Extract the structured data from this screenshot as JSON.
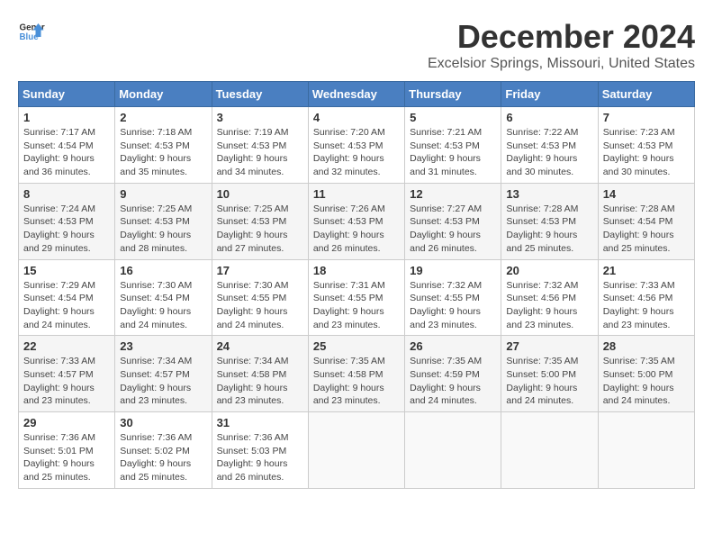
{
  "header": {
    "logo_line1": "General",
    "logo_line2": "Blue",
    "month": "December 2024",
    "location": "Excelsior Springs, Missouri, United States"
  },
  "days_of_week": [
    "Sunday",
    "Monday",
    "Tuesday",
    "Wednesday",
    "Thursday",
    "Friday",
    "Saturday"
  ],
  "weeks": [
    [
      {
        "day": "1",
        "sunrise": "Sunrise: 7:17 AM",
        "sunset": "Sunset: 4:54 PM",
        "daylight": "Daylight: 9 hours and 36 minutes."
      },
      {
        "day": "2",
        "sunrise": "Sunrise: 7:18 AM",
        "sunset": "Sunset: 4:53 PM",
        "daylight": "Daylight: 9 hours and 35 minutes."
      },
      {
        "day": "3",
        "sunrise": "Sunrise: 7:19 AM",
        "sunset": "Sunset: 4:53 PM",
        "daylight": "Daylight: 9 hours and 34 minutes."
      },
      {
        "day": "4",
        "sunrise": "Sunrise: 7:20 AM",
        "sunset": "Sunset: 4:53 PM",
        "daylight": "Daylight: 9 hours and 32 minutes."
      },
      {
        "day": "5",
        "sunrise": "Sunrise: 7:21 AM",
        "sunset": "Sunset: 4:53 PM",
        "daylight": "Daylight: 9 hours and 31 minutes."
      },
      {
        "day": "6",
        "sunrise": "Sunrise: 7:22 AM",
        "sunset": "Sunset: 4:53 PM",
        "daylight": "Daylight: 9 hours and 30 minutes."
      },
      {
        "day": "7",
        "sunrise": "Sunrise: 7:23 AM",
        "sunset": "Sunset: 4:53 PM",
        "daylight": "Daylight: 9 hours and 30 minutes."
      }
    ],
    [
      {
        "day": "8",
        "sunrise": "Sunrise: 7:24 AM",
        "sunset": "Sunset: 4:53 PM",
        "daylight": "Daylight: 9 hours and 29 minutes."
      },
      {
        "day": "9",
        "sunrise": "Sunrise: 7:25 AM",
        "sunset": "Sunset: 4:53 PM",
        "daylight": "Daylight: 9 hours and 28 minutes."
      },
      {
        "day": "10",
        "sunrise": "Sunrise: 7:25 AM",
        "sunset": "Sunset: 4:53 PM",
        "daylight": "Daylight: 9 hours and 27 minutes."
      },
      {
        "day": "11",
        "sunrise": "Sunrise: 7:26 AM",
        "sunset": "Sunset: 4:53 PM",
        "daylight": "Daylight: 9 hours and 26 minutes."
      },
      {
        "day": "12",
        "sunrise": "Sunrise: 7:27 AM",
        "sunset": "Sunset: 4:53 PM",
        "daylight": "Daylight: 9 hours and 26 minutes."
      },
      {
        "day": "13",
        "sunrise": "Sunrise: 7:28 AM",
        "sunset": "Sunset: 4:53 PM",
        "daylight": "Daylight: 9 hours and 25 minutes."
      },
      {
        "day": "14",
        "sunrise": "Sunrise: 7:28 AM",
        "sunset": "Sunset: 4:54 PM",
        "daylight": "Daylight: 9 hours and 25 minutes."
      }
    ],
    [
      {
        "day": "15",
        "sunrise": "Sunrise: 7:29 AM",
        "sunset": "Sunset: 4:54 PM",
        "daylight": "Daylight: 9 hours and 24 minutes."
      },
      {
        "day": "16",
        "sunrise": "Sunrise: 7:30 AM",
        "sunset": "Sunset: 4:54 PM",
        "daylight": "Daylight: 9 hours and 24 minutes."
      },
      {
        "day": "17",
        "sunrise": "Sunrise: 7:30 AM",
        "sunset": "Sunset: 4:55 PM",
        "daylight": "Daylight: 9 hours and 24 minutes."
      },
      {
        "day": "18",
        "sunrise": "Sunrise: 7:31 AM",
        "sunset": "Sunset: 4:55 PM",
        "daylight": "Daylight: 9 hours and 23 minutes."
      },
      {
        "day": "19",
        "sunrise": "Sunrise: 7:32 AM",
        "sunset": "Sunset: 4:55 PM",
        "daylight": "Daylight: 9 hours and 23 minutes."
      },
      {
        "day": "20",
        "sunrise": "Sunrise: 7:32 AM",
        "sunset": "Sunset: 4:56 PM",
        "daylight": "Daylight: 9 hours and 23 minutes."
      },
      {
        "day": "21",
        "sunrise": "Sunrise: 7:33 AM",
        "sunset": "Sunset: 4:56 PM",
        "daylight": "Daylight: 9 hours and 23 minutes."
      }
    ],
    [
      {
        "day": "22",
        "sunrise": "Sunrise: 7:33 AM",
        "sunset": "Sunset: 4:57 PM",
        "daylight": "Daylight: 9 hours and 23 minutes."
      },
      {
        "day": "23",
        "sunrise": "Sunrise: 7:34 AM",
        "sunset": "Sunset: 4:57 PM",
        "daylight": "Daylight: 9 hours and 23 minutes."
      },
      {
        "day": "24",
        "sunrise": "Sunrise: 7:34 AM",
        "sunset": "Sunset: 4:58 PM",
        "daylight": "Daylight: 9 hours and 23 minutes."
      },
      {
        "day": "25",
        "sunrise": "Sunrise: 7:35 AM",
        "sunset": "Sunset: 4:58 PM",
        "daylight": "Daylight: 9 hours and 23 minutes."
      },
      {
        "day": "26",
        "sunrise": "Sunrise: 7:35 AM",
        "sunset": "Sunset: 4:59 PM",
        "daylight": "Daylight: 9 hours and 24 minutes."
      },
      {
        "day": "27",
        "sunrise": "Sunrise: 7:35 AM",
        "sunset": "Sunset: 5:00 PM",
        "daylight": "Daylight: 9 hours and 24 minutes."
      },
      {
        "day": "28",
        "sunrise": "Sunrise: 7:35 AM",
        "sunset": "Sunset: 5:00 PM",
        "daylight": "Daylight: 9 hours and 24 minutes."
      }
    ],
    [
      {
        "day": "29",
        "sunrise": "Sunrise: 7:36 AM",
        "sunset": "Sunset: 5:01 PM",
        "daylight": "Daylight: 9 hours and 25 minutes."
      },
      {
        "day": "30",
        "sunrise": "Sunrise: 7:36 AM",
        "sunset": "Sunset: 5:02 PM",
        "daylight": "Daylight: 9 hours and 25 minutes."
      },
      {
        "day": "31",
        "sunrise": "Sunrise: 7:36 AM",
        "sunset": "Sunset: 5:03 PM",
        "daylight": "Daylight: 9 hours and 26 minutes."
      },
      null,
      null,
      null,
      null
    ]
  ]
}
